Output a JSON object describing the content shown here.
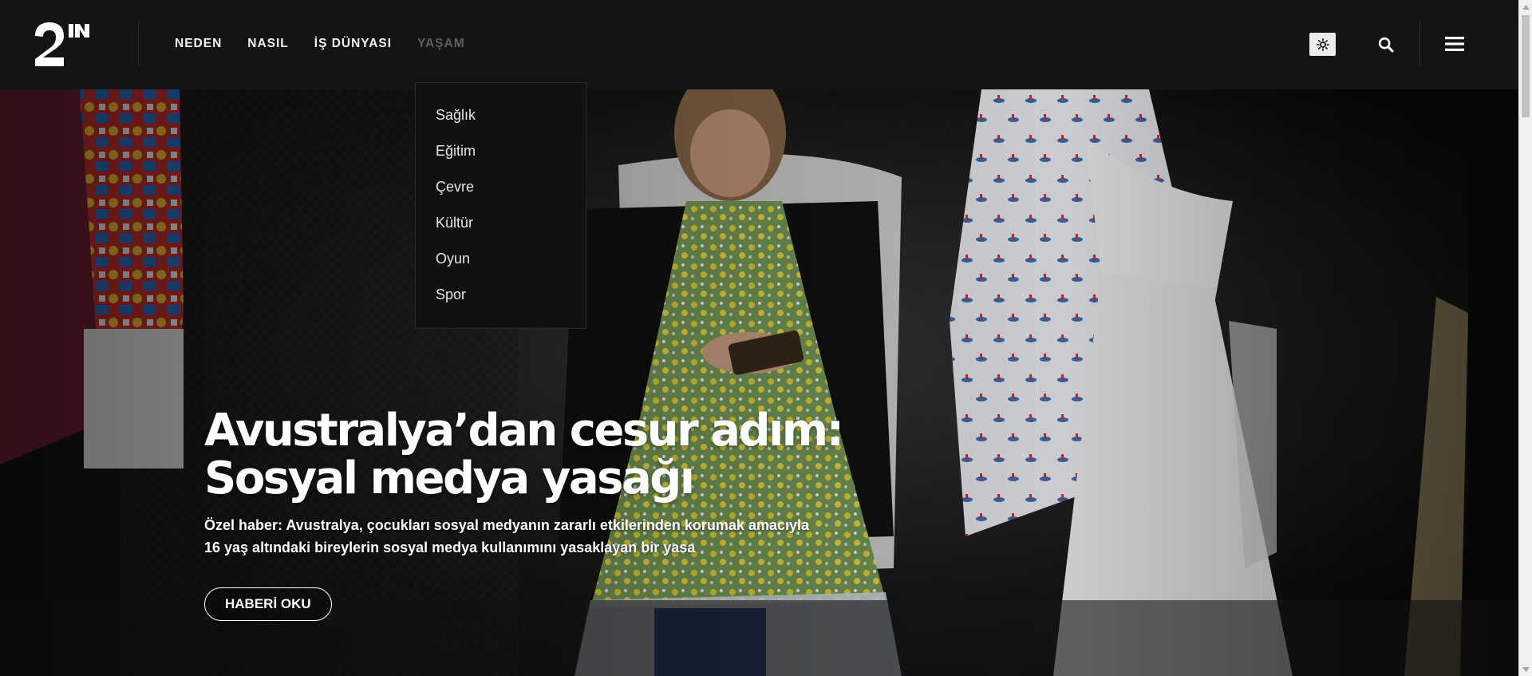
{
  "header": {
    "logo_alt": "2N",
    "nav": [
      {
        "label": "NEDEN",
        "active": false
      },
      {
        "label": "NASIL",
        "active": false
      },
      {
        "label": "İŞ DÜNYASI",
        "active": false
      },
      {
        "label": "YAŞAM",
        "active": true
      }
    ],
    "icons": {
      "theme_toggle": "sun-icon",
      "search": "search-icon",
      "menu": "hamburger-menu-icon"
    }
  },
  "dropdown": {
    "items": [
      "Sağlık",
      "Eğitim",
      "Çevre",
      "Kültür",
      "Oyun",
      "Spor"
    ]
  },
  "hero": {
    "headline_line1": "Avustralya’dan cesur adım:",
    "headline_line2": "Sosyal medya yasağı",
    "summary": "Özel haber: Avustralya, çocukları sosyal medyanın zararlı etkilerinden korumak amacıyla 16 yaş altındaki bireylerin sosyal medya kullanımını yasaklayan bir yasa",
    "button_label": "HABERİ OKU"
  },
  "colors": {
    "header_bg": "#141416",
    "active_nav": "#5e5e62",
    "text": "#ffffff"
  }
}
